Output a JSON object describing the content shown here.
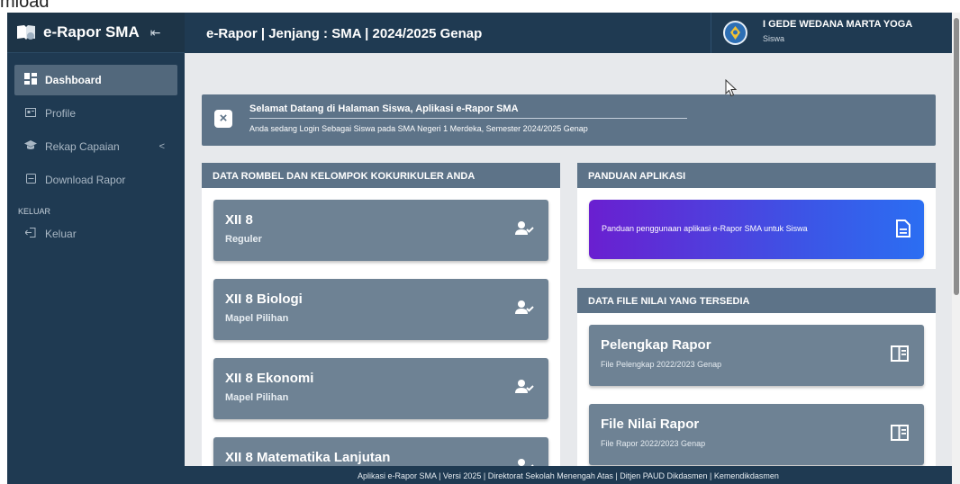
{
  "top_strip_text": "mload",
  "sidebar": {
    "brand_title": "e-Rapor SMA",
    "collapse_icon": "⇤",
    "items": [
      {
        "label": "Dashboard",
        "icon": "dashboard-icon",
        "active": true
      },
      {
        "label": "Profile",
        "icon": "profile-card-icon"
      },
      {
        "label": "Rekap Capaian",
        "icon": "graduation-cap-icon",
        "has_submenu": true
      },
      {
        "label": "Download Rapor",
        "icon": "document-icon"
      }
    ],
    "section_label": "KELUAR",
    "logout_label": "Keluar",
    "chevron": "<"
  },
  "header": {
    "title": "e-Rapor | Jenjang : SMA | 2024/2025 Genap",
    "user_name": "I GEDE WEDANA MARTA YOGA",
    "user_role": "Siswa"
  },
  "welcome": {
    "close": "×",
    "title": "Selamat Datang di Halaman Siswa, Aplikasi e-Rapor SMA",
    "subtitle": "Anda sedang Login Sebagai Siswa pada SMA Negeri 1 Merdeka, Semester 2024/2025 Genap"
  },
  "rombel_panel": {
    "heading": "DATA ROMBEL DAN KELOMPOK KOKURIKULER ANDA",
    "cards": [
      {
        "title": "XII 8",
        "subtitle": "Reguler"
      },
      {
        "title": "XII 8 Biologi",
        "subtitle": "Mapel Pilihan"
      },
      {
        "title": "XII 8 Ekonomi",
        "subtitle": "Mapel Pilihan"
      },
      {
        "title": "XII 8 Matematika Lanjutan",
        "subtitle": ""
      }
    ]
  },
  "guide_panel": {
    "heading": "PANDUAN APLIKASI",
    "card_text": "Panduan penggunaan aplikasi e-Rapor SMA untuk Siswa"
  },
  "files_panel": {
    "heading": "DATA FILE NILAI YANG TERSEDIA",
    "cards": [
      {
        "title": "Pelengkap Rapor",
        "subtitle": "File Pelengkap 2022/2023 Genap"
      },
      {
        "title": "File Nilai Rapor",
        "subtitle": "File Rapor 2022/2023 Genap"
      }
    ]
  },
  "footer": {
    "text": "Aplikasi e-Rapor SMA | Versi 2025 | Direktorat Sekolah Menengah Atas | Ditjen PAUD Dikdasmen | Kemendikdasmen"
  },
  "colors": {
    "sidebar": "#1f3a52",
    "panel_header": "#5d7388",
    "card": "#6e8294",
    "content_bg": "#e7e9ec",
    "guide_gradient_start": "#6a1fd0",
    "guide_gradient_end": "#2b6ef2"
  }
}
